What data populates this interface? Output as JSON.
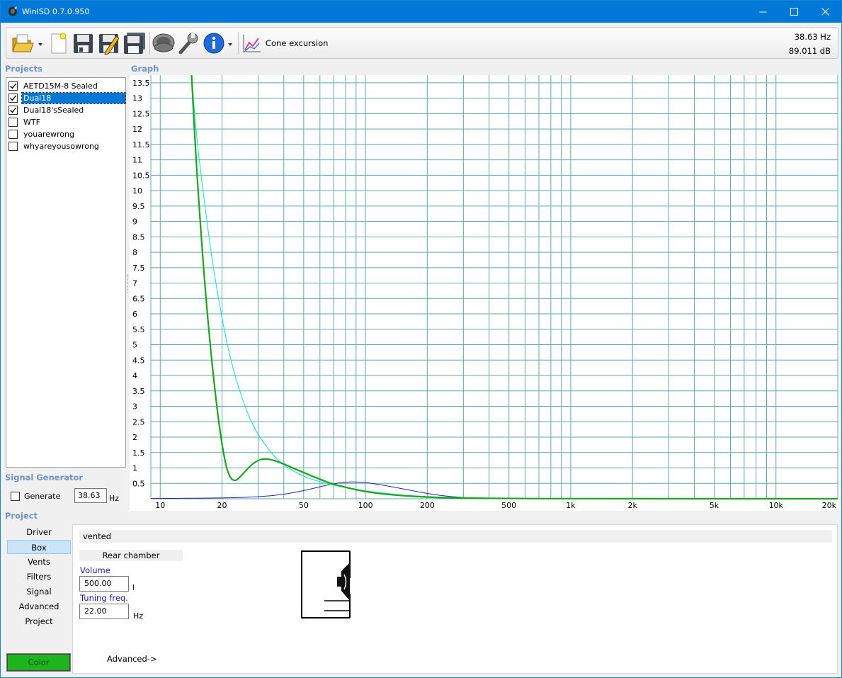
{
  "window": {
    "title": "WinISD 0.7.0.950"
  },
  "toolbar": {
    "graph_selector_label": "Cone excursion",
    "readout_frequency": "38.63 Hz",
    "readout_level": "89.011 dB"
  },
  "projects": {
    "label": "Projects",
    "items": [
      {
        "name": "AETD15M-8 Sealed",
        "checked": true,
        "selected": false
      },
      {
        "name": "Dual18",
        "checked": true,
        "selected": true
      },
      {
        "name": "Dual18'sSealed",
        "checked": true,
        "selected": false
      },
      {
        "name": "WTF",
        "checked": false,
        "selected": false
      },
      {
        "name": "youarewrong",
        "checked": false,
        "selected": false
      },
      {
        "name": "whyareyousowrong",
        "checked": false,
        "selected": false
      }
    ]
  },
  "graph": {
    "label": "Graph"
  },
  "chart_data": {
    "type": "line",
    "x_scale": "log",
    "xlim": [
      9,
      20000
    ],
    "ylim": [
      0,
      13.75
    ],
    "x_tick_labels": [
      {
        "value": 10,
        "label": "10"
      },
      {
        "value": 20,
        "label": "20"
      },
      {
        "value": 50,
        "label": "50"
      },
      {
        "value": 100,
        "label": "100"
      },
      {
        "value": 200,
        "label": "200"
      },
      {
        "value": 500,
        "label": "500"
      },
      {
        "value": 1000,
        "label": "1k"
      },
      {
        "value": 2000,
        "label": "2k"
      },
      {
        "value": 5000,
        "label": "5k"
      },
      {
        "value": 10000,
        "label": "10k"
      },
      {
        "value": 20000,
        "label": "20k"
      }
    ],
    "y_ticks": [
      0.5,
      1,
      1.5,
      2,
      2.5,
      3,
      3.5,
      4,
      4.5,
      5,
      5.5,
      6,
      6.5,
      7,
      7.5,
      8,
      8.5,
      9,
      9.5,
      10,
      10.5,
      11,
      11.5,
      12,
      12.5,
      13,
      13.5
    ],
    "grid": true,
    "colors": {
      "grid": "#5fa8b0",
      "green": "#1aa51a",
      "cyan": "#19e0d6",
      "navy": "#2323a0"
    },
    "series": [
      {
        "color": "green",
        "x": [
          14.2,
          15,
          16,
          17,
          18,
          19,
          20,
          21,
          22,
          23,
          24,
          26,
          28,
          30,
          32,
          35,
          40,
          45,
          50,
          60,
          70,
          80,
          100,
          130,
          200,
          300,
          500,
          1000,
          20000
        ],
        "y": [
          13.8,
          10.8,
          8.1,
          5.9,
          4.2,
          2.8,
          1.75,
          1.0,
          0.66,
          0.58,
          0.64,
          0.9,
          1.12,
          1.25,
          1.3,
          1.27,
          1.13,
          0.98,
          0.85,
          0.63,
          0.47,
          0.37,
          0.23,
          0.13,
          0.05,
          0.02,
          0.01,
          0,
          0
        ]
      },
      {
        "color": "cyan",
        "x": [
          14.2,
          15,
          16,
          18,
          20,
          22,
          25,
          28,
          30,
          35,
          40,
          50,
          60,
          70,
          80,
          100,
          150,
          200,
          300,
          500,
          1000,
          20000
        ],
        "y": [
          13.8,
          11.8,
          10.2,
          7.6,
          5.85,
          4.5,
          3.25,
          2.45,
          2.08,
          1.45,
          1.08,
          0.72,
          0.55,
          0.44,
          0.36,
          0.25,
          0.12,
          0.07,
          0.03,
          0.01,
          0,
          0
        ]
      },
      {
        "color": "navy",
        "x": [
          9,
          20,
          30,
          40,
          50,
          60,
          70,
          80,
          90,
          100,
          120,
          150,
          200,
          250,
          300,
          350,
          400,
          500,
          20000
        ],
        "y": [
          0.01,
          0.02,
          0.06,
          0.14,
          0.26,
          0.39,
          0.49,
          0.54,
          0.55,
          0.53,
          0.45,
          0.33,
          0.17,
          0.08,
          0.04,
          0.02,
          0.01,
          0,
          0
        ]
      }
    ]
  },
  "signal_generator": {
    "label": "Signal Generator",
    "generate_label": "Generate",
    "generate_checked": false,
    "frequency_value": "38.63",
    "frequency_unit": "Hz"
  },
  "project_nav": {
    "label": "Project",
    "items": [
      "Driver",
      "Box",
      "Vents",
      "Filters",
      "Signal",
      "Advanced",
      "Project"
    ],
    "active": "Box",
    "color_button": "Color",
    "color_value": "#1db41d"
  },
  "box_panel": {
    "header": "vented",
    "rear_chamber_label": "Rear chamber",
    "volume_label": "Volume",
    "volume_value": "500.00",
    "volume_unit": "l",
    "tuning_label": "Tuning freq.",
    "tuning_value": "22.00",
    "tuning_unit": "Hz",
    "advanced_link": "Advanced->"
  }
}
